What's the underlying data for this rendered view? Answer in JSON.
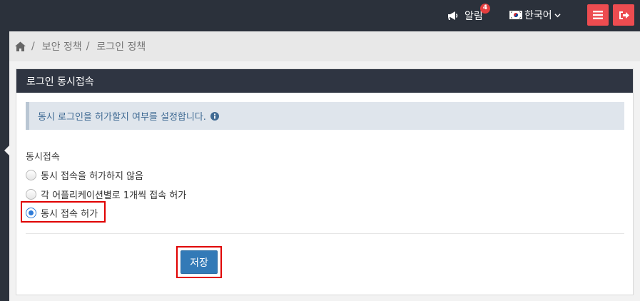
{
  "topbar": {
    "notification_label": "알림",
    "notification_count": "4",
    "language_label": "한국어"
  },
  "breadcrumb": {
    "items": [
      "보안 정책",
      "로그인 정책"
    ]
  },
  "panel": {
    "title": "로그인 동시접속",
    "info_text": "동시 로그인을 허가할지 여부를 설정합니다.",
    "field_label": "동시접속",
    "options": [
      {
        "label": "동시 접속을 허가하지 않음",
        "checked": false
      },
      {
        "label": "각 어플리케이션별로 1개씩 접속 허가",
        "checked": false
      },
      {
        "label": "동시 접속 허가",
        "checked": true
      }
    ],
    "save_label": "저장"
  },
  "colors": {
    "topbar": "#2b313b",
    "accent_button": "#ed4c50",
    "primary_button": "#337ab7",
    "highlight": "#e00000"
  },
  "icons": [
    "megaphone-icon",
    "korea-flag-icon",
    "chevron-down-icon",
    "hamburger-icon",
    "logout-icon",
    "home-icon",
    "info-icon"
  ]
}
